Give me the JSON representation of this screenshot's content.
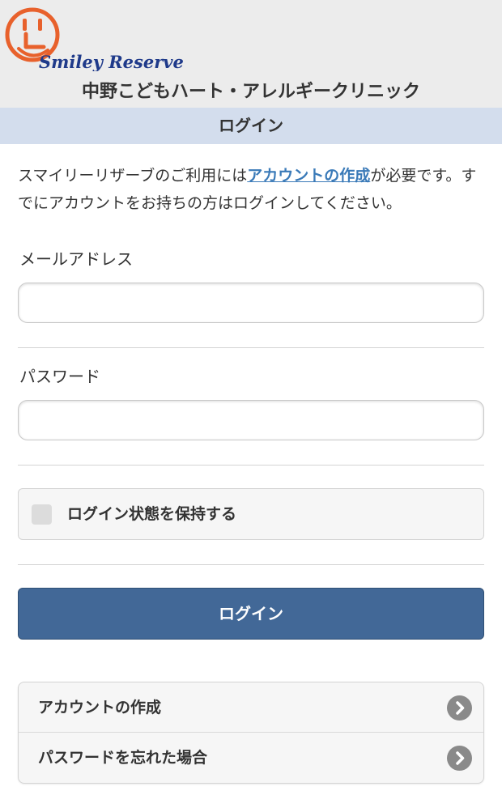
{
  "header": {
    "logo_text": "Smiley Reserve",
    "clinic_name": "中野こどもハート・アレルギークリニック"
  },
  "page_title": "ログイン",
  "intro": {
    "before_link": "スマイリーリザーブのご利用には",
    "link_text": "アカウントの作成",
    "after_link": "が必要です。すでにアカウントをお持ちの方はログインしてください。"
  },
  "form": {
    "email_label": "メールアドレス",
    "email_value": "",
    "password_label": "パスワード",
    "password_value": "",
    "remember_label": "ログイン状態を保持する",
    "remember_checked": false,
    "login_button": "ログイン"
  },
  "links": [
    {
      "label": "アカウントの作成",
      "icon": "chevron-right-icon"
    },
    {
      "label": "パスワードを忘れた場合",
      "icon": "chevron-right-icon"
    }
  ],
  "colors": {
    "header_bg": "#ececec",
    "title_bar_bg": "#d3dded",
    "link_color": "#3a7ab8",
    "logo_orange": "#e8612c",
    "logo_navy": "#1f3a8a",
    "button_bg": "#426897"
  }
}
